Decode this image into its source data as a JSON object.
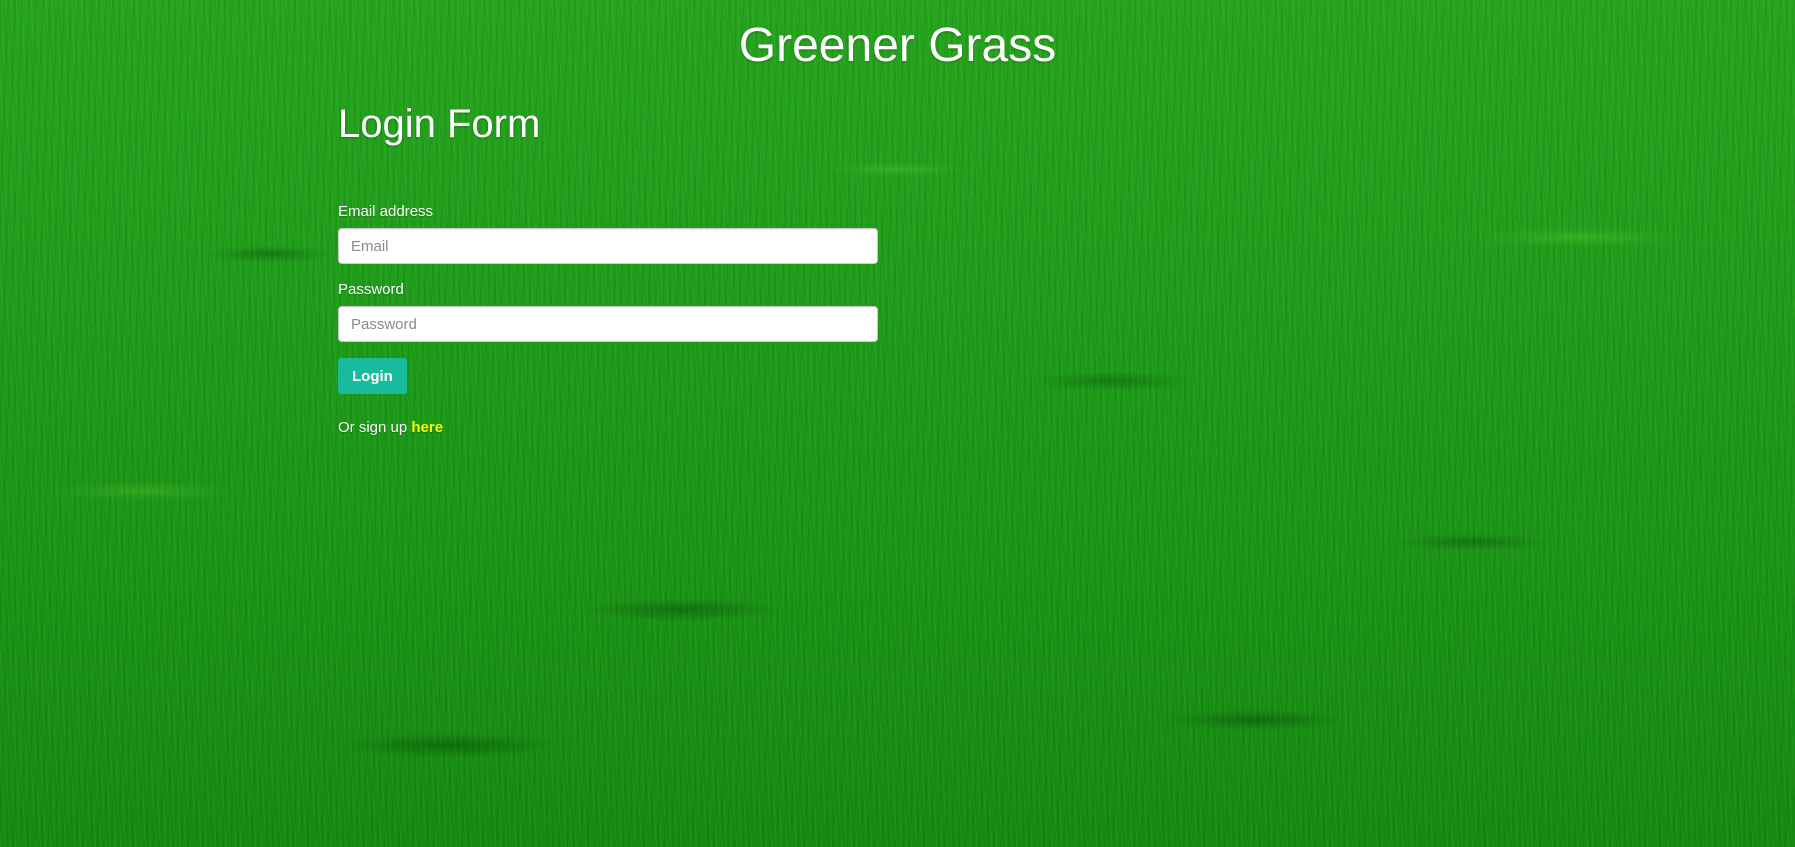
{
  "header": {
    "site_title": "Greener Grass"
  },
  "login_form": {
    "heading": "Login Form",
    "email": {
      "label": "Email address",
      "placeholder": "Email",
      "value": ""
    },
    "password": {
      "label": "Password",
      "placeholder": "Password",
      "value": ""
    },
    "submit_label": "Login",
    "signup_prompt": "Or sign up ",
    "signup_link_text": "here"
  },
  "colors": {
    "background_grass": "#1f9a1f",
    "button_accent": "#18bc9c",
    "link_yellow": "#ffff00",
    "text": "#ffffff"
  }
}
